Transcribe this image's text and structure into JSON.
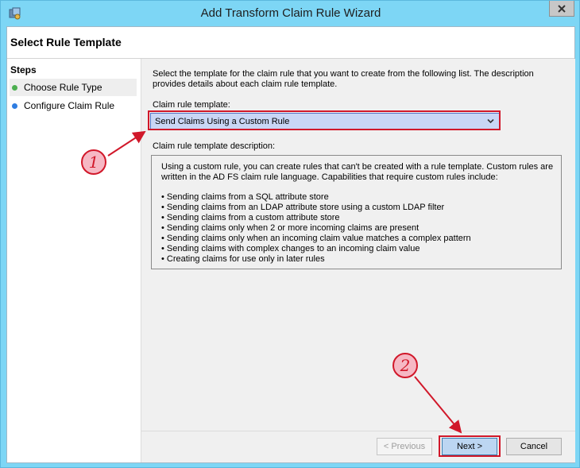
{
  "window": {
    "title": "Add Transform Claim Rule Wizard",
    "close_icon": "close-icon"
  },
  "header": {
    "title": "Select Rule Template"
  },
  "steps": {
    "heading": "Steps",
    "items": [
      {
        "label": "Choose Rule Type",
        "dot_color": "#4caf50"
      },
      {
        "label": "Configure Claim Rule",
        "dot_color": "#2f7de1"
      }
    ]
  },
  "main": {
    "intro": "Select the template for the claim rule that you want to create from the following list. The description provides details about each claim rule template.",
    "template_label": "Claim rule template:",
    "template_value": "Send Claims Using a Custom Rule",
    "description_label": "Claim rule template description:",
    "description": "Using a custom rule, you can create rules that can't be created with a rule template.  Custom rules are written in the AD FS claim rule language.  Capabilities that require custom rules include:",
    "bullets": [
      "• Sending claims from a SQL attribute store",
      "• Sending claims from an LDAP attribute store using a custom LDAP filter",
      "• Sending claims from a custom attribute store",
      "• Sending claims only when 2 or more incoming claims are present",
      "• Sending claims only when an incoming claim value matches a complex pattern",
      "• Sending claims with complex changes to an incoming claim value",
      "• Creating claims for use only in later rules"
    ]
  },
  "buttons": {
    "previous": "< Previous",
    "next": "Next >",
    "cancel": "Cancel"
  },
  "annotations": {
    "callout_1": "1",
    "callout_2": "2",
    "color": "#d1182a"
  }
}
